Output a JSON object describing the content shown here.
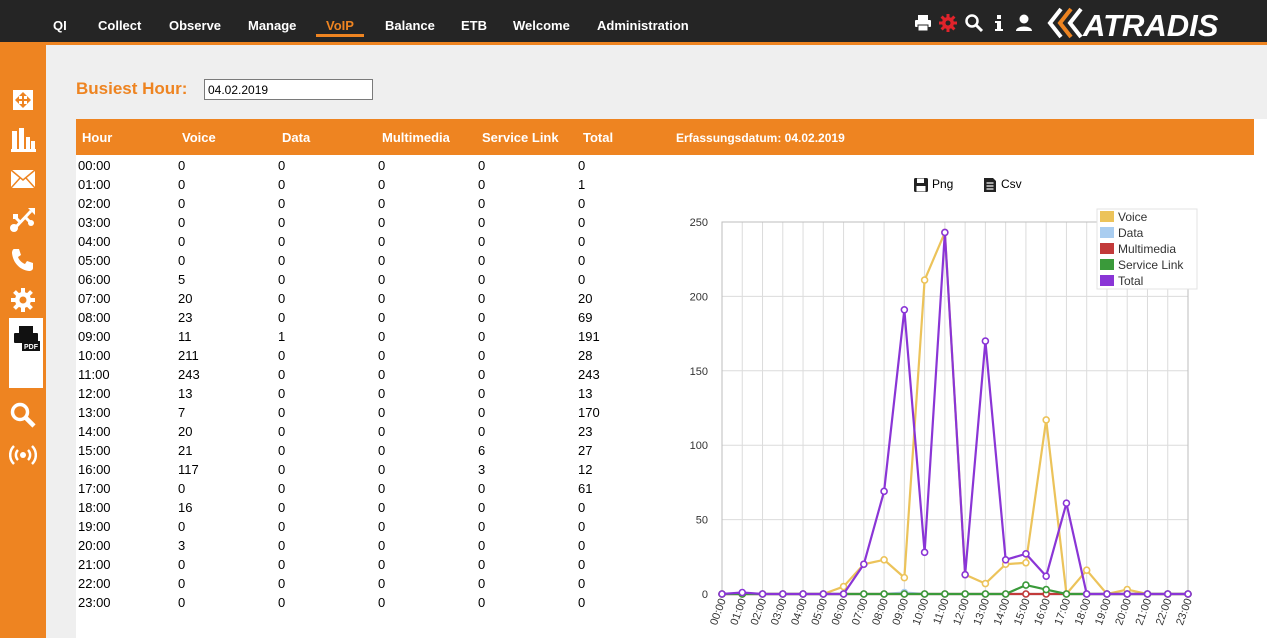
{
  "nav": {
    "items": [
      "QI",
      "Collect",
      "Observe",
      "Manage",
      "VoIP",
      "Balance",
      "ETB",
      "Welcome",
      "Administration"
    ],
    "active": "VoIP"
  },
  "top_icons": [
    "print-icon",
    "settings-gear-icon",
    "search-icon",
    "info-icon",
    "user-icon"
  ],
  "brand": {
    "logo_text": "ATRADIS",
    "accent": "#ee8421",
    "dark": "#252525"
  },
  "sidebar": {
    "icons": [
      "move-arrows-icon",
      "bar-chart-icon",
      "network-map-icon",
      "usb-icon",
      "phone-icon",
      "gear-icon",
      "print-pdf-icon",
      "zoom-icon",
      "broadcast-icon"
    ],
    "active": "print-pdf-icon",
    "pdf_badge": "PDF"
  },
  "filter": {
    "label": "Busiest Hour:",
    "date_value": "04.02.2019"
  },
  "table": {
    "columns": [
      "Hour",
      "Voice",
      "Data",
      "Multimedia",
      "Service Link",
      "Total"
    ],
    "rows": [
      [
        "00:00",
        "0",
        "0",
        "0",
        "0",
        "0"
      ],
      [
        "01:00",
        "0",
        "0",
        "0",
        "0",
        "1"
      ],
      [
        "02:00",
        "0",
        "0",
        "0",
        "0",
        "0"
      ],
      [
        "03:00",
        "0",
        "0",
        "0",
        "0",
        "0"
      ],
      [
        "04:00",
        "0",
        "0",
        "0",
        "0",
        "0"
      ],
      [
        "05:00",
        "0",
        "0",
        "0",
        "0",
        "0"
      ],
      [
        "06:00",
        "5",
        "0",
        "0",
        "0",
        "0"
      ],
      [
        "07:00",
        "20",
        "0",
        "0",
        "0",
        "20"
      ],
      [
        "08:00",
        "23",
        "0",
        "0",
        "0",
        "69"
      ],
      [
        "09:00",
        "11",
        "1",
        "0",
        "0",
        "191"
      ],
      [
        "10:00",
        "211",
        "0",
        "0",
        "0",
        "28"
      ],
      [
        "11:00",
        "243",
        "0",
        "0",
        "0",
        "243"
      ],
      [
        "12:00",
        "13",
        "0",
        "0",
        "0",
        "13"
      ],
      [
        "13:00",
        "7",
        "0",
        "0",
        "0",
        "170"
      ],
      [
        "14:00",
        "20",
        "0",
        "0",
        "0",
        "23"
      ],
      [
        "15:00",
        "21",
        "0",
        "0",
        "6",
        "27"
      ],
      [
        "16:00",
        "117",
        "0",
        "0",
        "3",
        "12"
      ],
      [
        "17:00",
        "0",
        "0",
        "0",
        "0",
        "61"
      ],
      [
        "18:00",
        "16",
        "0",
        "0",
        "0",
        "0"
      ],
      [
        "19:00",
        "0",
        "0",
        "0",
        "0",
        "0"
      ],
      [
        "20:00",
        "3",
        "0",
        "0",
        "0",
        "0"
      ],
      [
        "21:00",
        "0",
        "0",
        "0",
        "0",
        "0"
      ],
      [
        "22:00",
        "0",
        "0",
        "0",
        "0",
        "0"
      ],
      [
        "23:00",
        "0",
        "0",
        "0",
        "0",
        "0"
      ]
    ]
  },
  "chart_panel": {
    "title": "Erfassungsdatum: 04.02.2019",
    "export_png": "Png",
    "export_csv": "Csv"
  },
  "chart_data": {
    "type": "line",
    "x": [
      "00:00",
      "01:00",
      "02:00",
      "03:00",
      "04:00",
      "05:00",
      "06:00",
      "07:00",
      "08:00",
      "09:00",
      "10:00",
      "11:00",
      "12:00",
      "13:00",
      "14:00",
      "15:00",
      "16:00",
      "17:00",
      "18:00",
      "19:00",
      "20:00",
      "21:00",
      "22:00",
      "23:00"
    ],
    "ylim": [
      0,
      250
    ],
    "yticks": [
      0,
      50,
      100,
      150,
      200,
      250
    ],
    "grid": true,
    "legend_position": "top-right",
    "series": [
      {
        "name": "Voice",
        "color": "#ecc35a",
        "values": [
          0,
          0,
          0,
          0,
          0,
          0,
          5,
          20,
          23,
          11,
          211,
          243,
          13,
          7,
          20,
          21,
          117,
          0,
          16,
          0,
          3,
          0,
          0,
          0
        ]
      },
      {
        "name": "Data",
        "color": "#a9cdf0",
        "values": [
          0,
          0,
          0,
          0,
          0,
          0,
          0,
          0,
          0,
          1,
          0,
          0,
          0,
          0,
          0,
          0,
          0,
          0,
          0,
          0,
          0,
          0,
          0,
          0
        ]
      },
      {
        "name": "Multimedia",
        "color": "#c23a3a",
        "values": [
          0,
          0,
          0,
          0,
          0,
          0,
          0,
          0,
          0,
          0,
          0,
          0,
          0,
          0,
          0,
          0,
          0,
          0,
          0,
          0,
          0,
          0,
          0,
          0
        ]
      },
      {
        "name": "Service Link",
        "color": "#3a9a3a",
        "values": [
          0,
          0,
          0,
          0,
          0,
          0,
          0,
          0,
          0,
          0,
          0,
          0,
          0,
          0,
          0,
          6,
          3,
          0,
          0,
          0,
          0,
          0,
          0,
          0
        ]
      },
      {
        "name": "Total",
        "color": "#8a35d6",
        "values": [
          0,
          1,
          0,
          0,
          0,
          0,
          0,
          20,
          69,
          191,
          28,
          243,
          13,
          170,
          23,
          27,
          12,
          61,
          0,
          0,
          0,
          0,
          0,
          0
        ]
      }
    ]
  }
}
